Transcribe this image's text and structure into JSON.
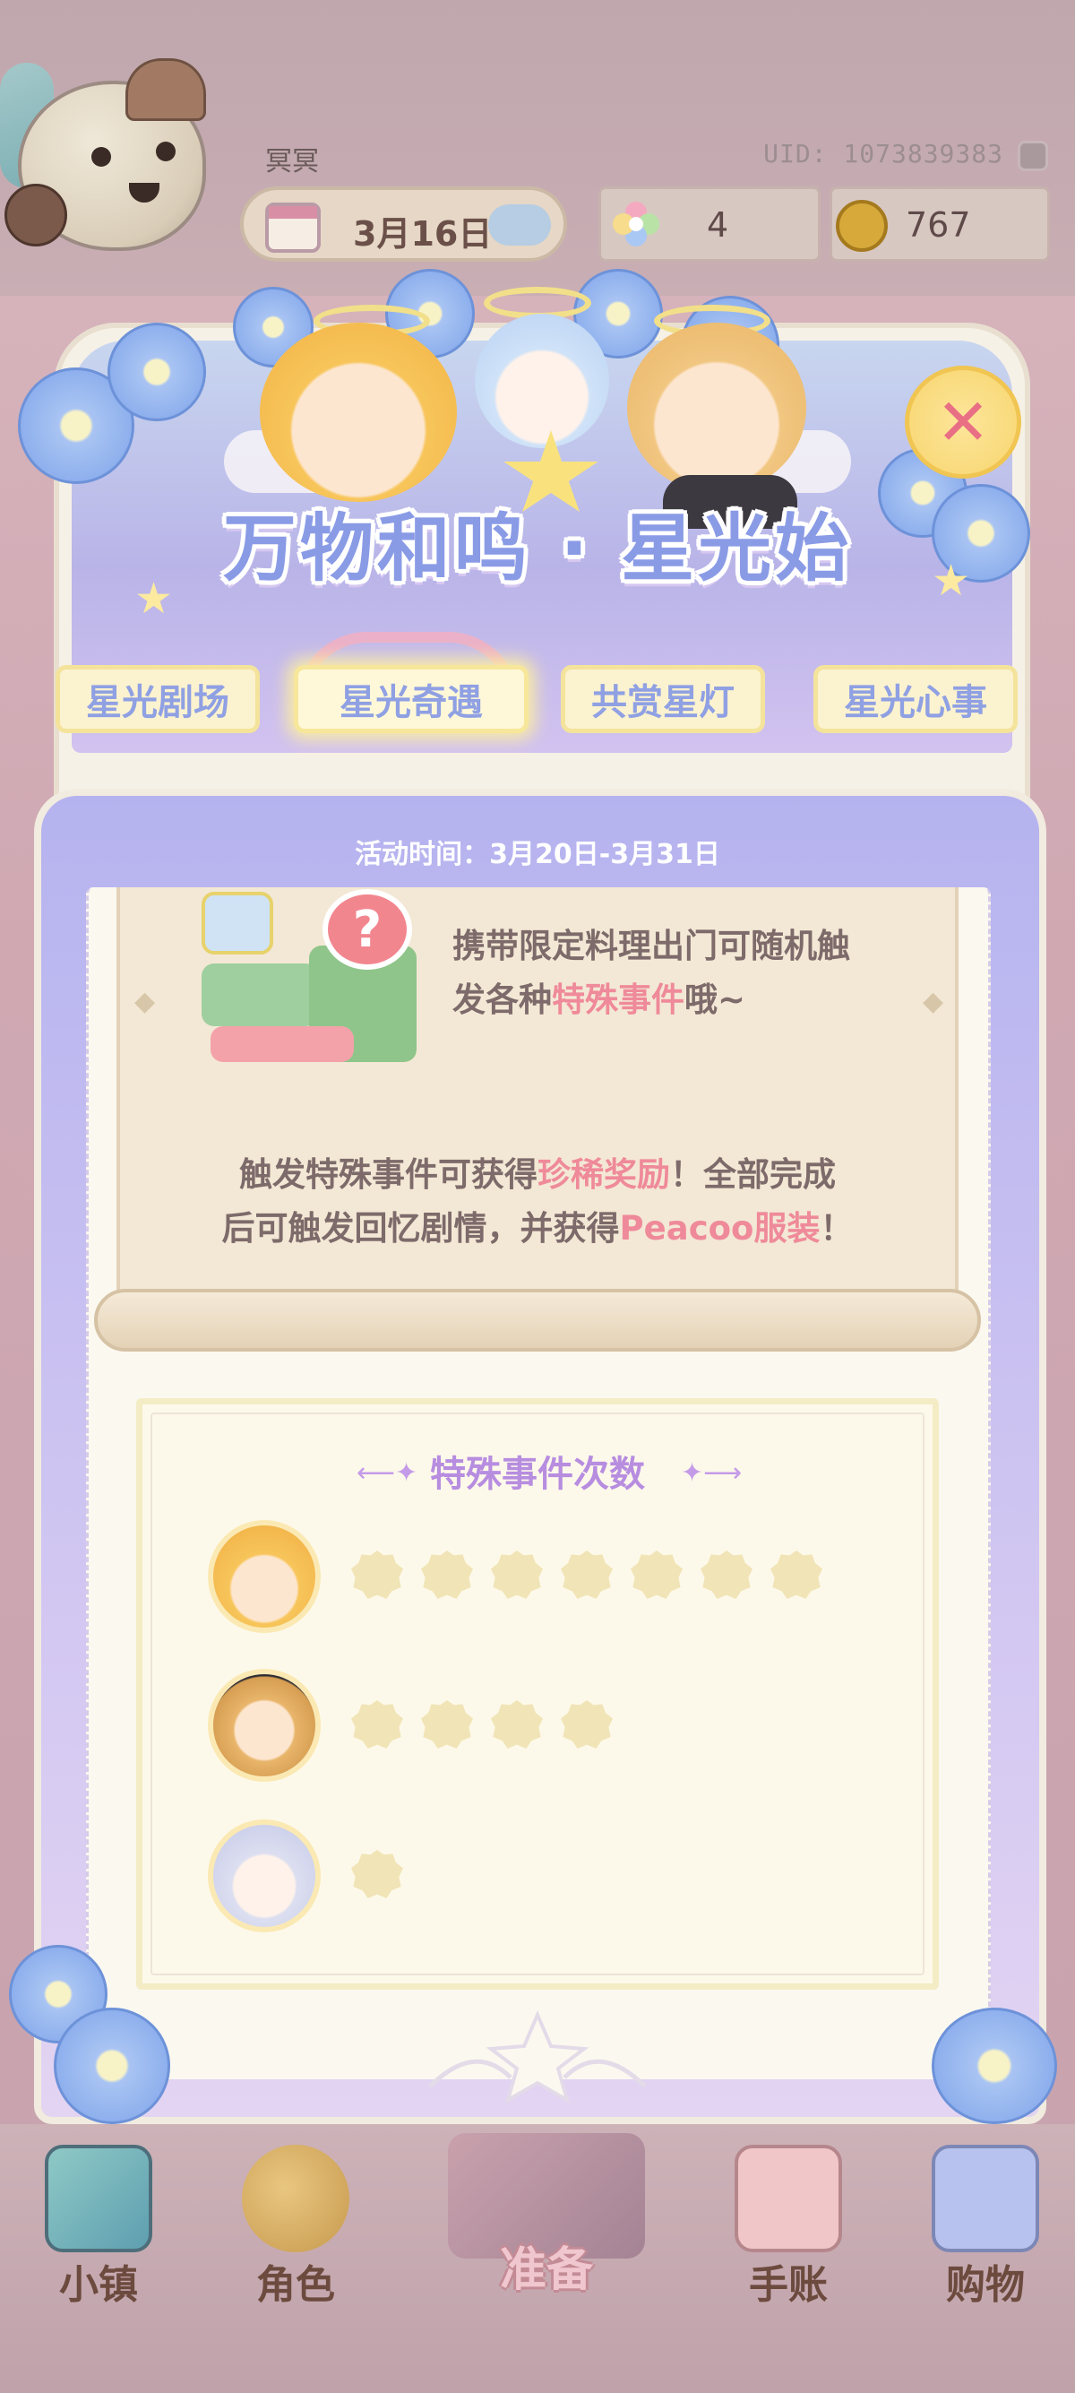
{
  "hud": {
    "player_name": "冥冥",
    "uid": "UID: 1073839383",
    "date": "3月16日",
    "gems": "4",
    "coins": "767"
  },
  "event": {
    "title": "万物和鸣 · 星光始",
    "activity_time": "活动时间：3月20日-3月31日",
    "tabs": [
      {
        "label": "星光剧场",
        "active": false
      },
      {
        "label": "星光奇遇",
        "active": true
      },
      {
        "label": "共赏星灯",
        "active": false
      },
      {
        "label": "星光心事",
        "active": false
      }
    ]
  },
  "description": {
    "line1": "携带限定料理出门可随机触",
    "line2_prefix": "发各种",
    "line2_highlight": "特殊事件",
    "line2_suffix": "哦~",
    "line3_prefix": "触发特殊事件可获得",
    "line3_highlight": "珍稀奖励",
    "line3_suffix": "！全部完成",
    "line4_prefix": "后可触发回忆剧情，并获得",
    "line4_highlight": "Peacoo服装",
    "line4_suffix": "！"
  },
  "counter": {
    "title": "特殊事件次数",
    "rows": [
      {
        "character": "blonde-girl",
        "count": 7
      },
      {
        "character": "curly-boy",
        "count": 4
      },
      {
        "character": "silver-hair-child",
        "count": 1
      }
    ]
  },
  "colors": {
    "accent_blue": "#8a9be6",
    "highlight_pink": "#ef8a9a",
    "counter_title": "#b78de0"
  },
  "nav": {
    "items": [
      {
        "label": "小镇",
        "icon": "map-icon"
      },
      {
        "label": "角色",
        "icon": "character-icon"
      },
      {
        "label": "准备",
        "icon": "picnic-basket-icon"
      },
      {
        "label": "手账",
        "icon": "journal-icon"
      },
      {
        "label": "购物",
        "icon": "shopping-bag-icon"
      }
    ]
  }
}
